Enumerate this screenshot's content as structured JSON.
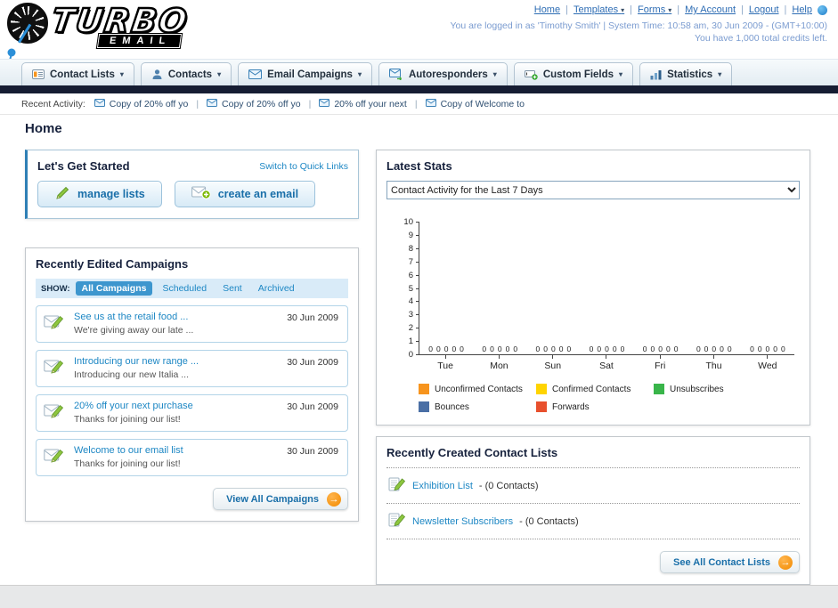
{
  "colors": {
    "link_blue": "#1d87c4",
    "dark_bar": "#161d33",
    "accent_orange": "#f7941d",
    "button_text_blue": "#1a6fa9"
  },
  "header": {
    "logo": {
      "word": "TURBO",
      "sub": "EMAIL"
    },
    "top_links": [
      {
        "id": "home",
        "label": "Home",
        "dropdown": false
      },
      {
        "id": "templates",
        "label": "Templates",
        "dropdown": true
      },
      {
        "id": "forms",
        "label": "Forms",
        "dropdown": true
      },
      {
        "id": "my-account",
        "label": "My Account",
        "dropdown": false
      },
      {
        "id": "logout",
        "label": "Logout",
        "dropdown": false
      },
      {
        "id": "help",
        "label": "Help",
        "dropdown": false
      }
    ],
    "session_line": "You are logged in as 'Timothy Smith' | System Time: 10:58 am, 30 Jun 2009 - (GMT+10:00)",
    "credits_line": "You have 1,000 total credits left."
  },
  "nav": {
    "items": [
      {
        "id": "contact-lists",
        "label": "Contact Lists",
        "icon": "contact-lists-icon"
      },
      {
        "id": "contacts",
        "label": "Contacts",
        "icon": "contacts-icon"
      },
      {
        "id": "email-campaigns",
        "label": "Email Campaigns",
        "icon": "email-campaigns-icon"
      },
      {
        "id": "autoresponders",
        "label": "Autoresponders",
        "icon": "autoresponders-icon"
      },
      {
        "id": "custom-fields",
        "label": "Custom Fields",
        "icon": "custom-fields-icon"
      },
      {
        "id": "statistics",
        "label": "Statistics",
        "icon": "statistics-icon"
      }
    ]
  },
  "recent_activity": {
    "label": "Recent Activity:",
    "items": [
      "Copy of 20% off yo",
      "Copy of 20% off yo",
      "20% off your next",
      "Copy of Welcome to"
    ]
  },
  "page_title": "Home",
  "get_started": {
    "title": "Let's Get Started",
    "switch_link": "Switch to Quick Links",
    "manage_lists_label": "manage lists",
    "create_email_label": "create an email"
  },
  "campaigns": {
    "title": "Recently Edited Campaigns",
    "show_label": "SHOW:",
    "tabs": [
      "All Campaigns",
      "Scheduled",
      "Sent",
      "Archived"
    ],
    "active_tab": "All Campaigns",
    "items": [
      {
        "title": "See us at the retail food ...",
        "subtitle": "We're giving away our late ...",
        "date": "30 Jun 2009"
      },
      {
        "title": "Introducing our new range ...",
        "subtitle": "Introducing our new Italia ...",
        "date": "30 Jun 2009"
      },
      {
        "title": "20% off your next purchase",
        "subtitle": "Thanks for joining our list!",
        "date": "30 Jun 2009"
      },
      {
        "title": "Welcome to our email list",
        "subtitle": "Thanks for joining our list!",
        "date": "30 Jun 2009"
      }
    ],
    "view_all_label": "View All Campaigns"
  },
  "stats": {
    "title": "Latest Stats",
    "activity_option": "Contact Activity for the Last 7 Days",
    "chart_data": {
      "type": "bar",
      "title": "Contact Activity for the Last 7 Days",
      "categories": [
        "Tue",
        "Mon",
        "Sun",
        "Sat",
        "Fri",
        "Thu",
        "Wed"
      ],
      "series": [
        {
          "name": "Unconfirmed Contacts",
          "color": "#f7941d",
          "values": [
            0,
            0,
            0,
            0,
            0,
            0,
            0
          ]
        },
        {
          "name": "Confirmed Contacts",
          "color": "#ffd400",
          "values": [
            0,
            0,
            0,
            0,
            0,
            0,
            0
          ]
        },
        {
          "name": "Unsubscribes",
          "color": "#39b54a",
          "values": [
            0,
            0,
            0,
            0,
            0,
            0,
            0
          ]
        },
        {
          "name": "Bounces",
          "color": "#4a6fa5",
          "values": [
            0,
            0,
            0,
            0,
            0,
            0,
            0
          ]
        },
        {
          "name": "Forwards",
          "color": "#e8502d",
          "values": [
            0,
            0,
            0,
            0,
            0,
            0,
            0
          ]
        }
      ],
      "ylim": [
        0,
        10
      ],
      "ytick_step": 1,
      "grid": false,
      "legend_position": "bottom"
    }
  },
  "contact_lists": {
    "title": "Recently Created Contact Lists",
    "items": [
      {
        "name": "Exhibition List",
        "suffix": "- (0 Contacts)"
      },
      {
        "name": "Newsletter Subscribers",
        "suffix": "- (0 Contacts)"
      }
    ],
    "see_all_label": "See All Contact Lists"
  }
}
